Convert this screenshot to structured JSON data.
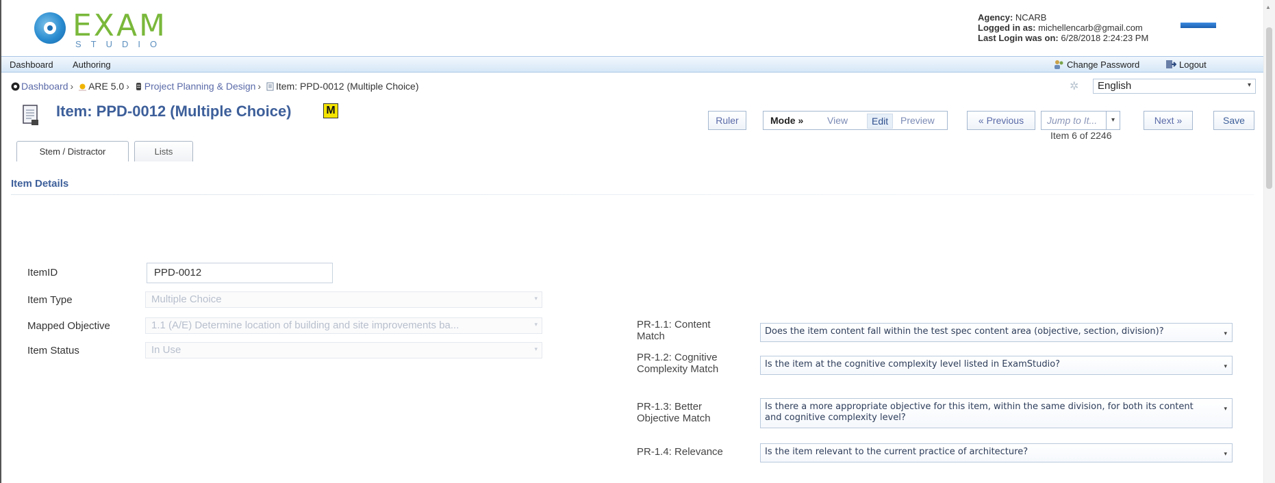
{
  "header": {
    "logo_text": "EXAM",
    "logo_sub": "STUDIO",
    "agency_label": "Agency:",
    "agency_value": "NCARB",
    "logged_label": "Logged in as:",
    "logged_value": "michellencarb@gmail.com",
    "last_login_label": "Last Login was on:",
    "last_login_value": "6/28/2018 2:24:23 PM",
    "brand_mark": "NCARB"
  },
  "nav": {
    "dashboard": "Dashboard",
    "authoring": "Authoring",
    "change_password": "Change Password",
    "logout": "Logout"
  },
  "breadcrumb": {
    "items": [
      "Dashboard",
      "ARE 5.0",
      "Project Planning & Design"
    ],
    "current": "Item: PPD-0012 (Multiple Choice)",
    "separator": "›"
  },
  "language": {
    "selected": "English"
  },
  "title": {
    "text": "Item: PPD-0012 (Multiple Choice)",
    "badge": "M"
  },
  "toolbar": {
    "ruler": "Ruler",
    "mode_label": "Mode »",
    "mode_view": "View",
    "mode_edit": "Edit",
    "mode_preview": "Preview",
    "previous": "« Previous",
    "jump_placeholder": "Jump to It...",
    "next": "Next »",
    "save": "Save",
    "item_count": "Item 6 of 2246"
  },
  "tabs": [
    "Stem / Distractor",
    "Lists"
  ],
  "section": {
    "title": "Item Details"
  },
  "form": {
    "item_id_label": "ItemID",
    "item_id_value": "PPD-0012",
    "item_type_label": "Item Type",
    "item_type_value": "Multiple Choice",
    "mapped_objective_label": "Mapped Objective",
    "mapped_objective_value": "1.1 (A/E) Determine location of building and site improvements ba...",
    "item_status_label": "Item Status",
    "item_status_value": "In Use"
  },
  "review": [
    {
      "label": "PR-1.1: Content Match",
      "value": "Does the item content fall within the test spec content area (objective, section, division)?"
    },
    {
      "label": "PR-1.2: Cognitive Complexity Match",
      "value": "Is the item at the cognitive complexity level listed in ExamStudio?"
    },
    {
      "label": "PR-1.3: Better Objective Match",
      "value": "Is there a more appropriate objective for this item, within the same division, for both its content and cognitive complexity level?"
    },
    {
      "label": "PR-1.4: Relevance",
      "value": "Is the item relevant to the current practice of architecture?"
    }
  ],
  "colors": {
    "accent": "#3d5f9a",
    "link": "#5a6aa8",
    "logo_green": "#7ab83b",
    "badge_yellow": "#f4e400"
  }
}
